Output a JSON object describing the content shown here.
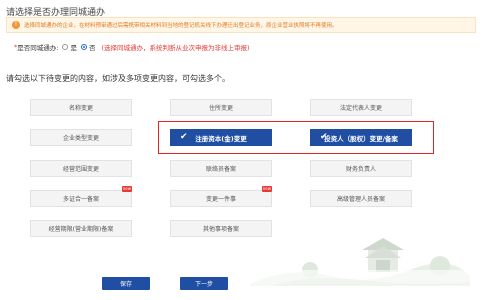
{
  "page": {
    "title": "请选择是否办理同城通办"
  },
  "notice": {
    "icon": "warning-icon",
    "text": "选择同城通办的企业，在材料预审通过后需携带相关材料到当地的登记机关线下办理迁出登记业务，原企业营业执照将不再使用。"
  },
  "same_city": {
    "label": "是否同城通办:",
    "options": [
      "是",
      "否"
    ],
    "selected": "否",
    "hint": "(选择同城通办，系统判断从业次申报为非线上审报)"
  },
  "instruction": "请勾选以下待变更的内容，如涉及多项变更内容，可勾选多个。",
  "options": [
    {
      "label": "名称变更",
      "selected": false,
      "badge": ""
    },
    {
      "label": "住所变更",
      "selected": false,
      "badge": ""
    },
    {
      "label": "法定代表人变更",
      "selected": false,
      "badge": ""
    },
    {
      "label": "企业类型变更",
      "selected": false,
      "badge": ""
    },
    {
      "label": "注册资本(金)变更",
      "selected": true,
      "badge": ""
    },
    {
      "label": "投资人（股权）变更/备案",
      "selected": true,
      "badge": ""
    },
    {
      "label": "经营范围变更",
      "selected": false,
      "badge": ""
    },
    {
      "label": "联络员备案",
      "selected": false,
      "badge": ""
    },
    {
      "label": "财务负责人",
      "selected": false,
      "badge": ""
    },
    {
      "label": "多证合一备案",
      "selected": false,
      "badge": "new"
    },
    {
      "label": "变更一件事",
      "selected": false,
      "badge": "new"
    },
    {
      "label": "高级管理人员备案",
      "selected": false,
      "badge": ""
    },
    {
      "label": "经营期限(营业期限)备案",
      "selected": false,
      "badge": ""
    },
    {
      "label": "其他事项备案",
      "selected": false,
      "badge": ""
    }
  ],
  "buttons": {
    "save": "保存",
    "next": "下一步"
  },
  "colors": {
    "accent": "#1f4ea3",
    "highlight": "#e02525",
    "notice_text": "#e07a20"
  }
}
